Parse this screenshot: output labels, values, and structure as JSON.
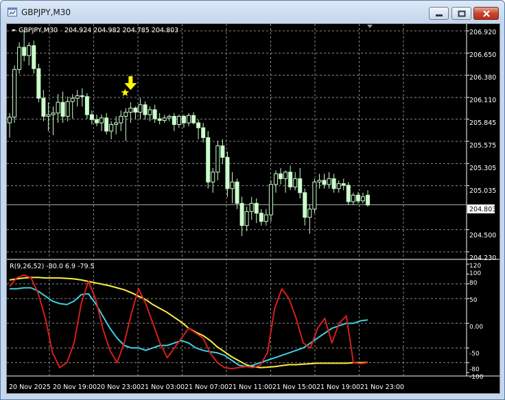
{
  "window": {
    "title": "GBPJPY,M30"
  },
  "chart_header": {
    "symbol": "GBPJPY,M30",
    "ohlc": "204.924 204.982 204.785 204.803"
  },
  "price_axis": {
    "labels": [
      "206.920",
      "206.650",
      "206.380",
      "206.110",
      "205.845",
      "205.575",
      "205.305",
      "205.035",
      "204.500",
      "204.230"
    ],
    "current_price": "204.803"
  },
  "indicator": {
    "label": "R(9,26,52) -80.0 6.9 -79.5",
    "axis_labels": [
      "120",
      "100",
      "80",
      "50",
      "0.00",
      "-50",
      "-80",
      "-100"
    ]
  },
  "time_axis": {
    "labels": [
      "20 Nov 2025",
      "20 Nov 19:00",
      "20 Nov 23:00",
      "21 Nov 03:00",
      "21 Nov 07:00",
      "21 Nov 11:00",
      "21 Nov 15:00",
      "21 Nov 19:00",
      "21 Nov 23:00"
    ]
  },
  "colors": {
    "background": "#000000",
    "grid": "#8c8c8c",
    "candle": "#ccffcc",
    "current_price_line": "#b4b4b4",
    "marker": "#ffff00",
    "fast_line": "#d81e1e",
    "mid_line": "#40d0e0",
    "slow_line": "#ffee40"
  },
  "icons": {
    "app": "chart-window-icon",
    "signal_marker": "down-arrow-icon",
    "signal_star": "star-icon"
  },
  "chart_data": {
    "type": "candlestick",
    "price_range": [
      204.23,
      206.92
    ],
    "candles": [
      [
        205.8,
        205.92,
        205.62,
        205.87
      ],
      [
        205.87,
        206.5,
        205.8,
        206.45
      ],
      [
        206.45,
        206.78,
        206.4,
        206.72
      ],
      [
        206.72,
        206.92,
        206.55,
        206.62
      ],
      [
        206.62,
        206.78,
        206.5,
        206.74
      ],
      [
        206.74,
        206.8,
        206.4,
        206.46
      ],
      [
        206.46,
        206.52,
        206.05,
        206.1
      ],
      [
        206.1,
        206.2,
        205.82,
        205.88
      ],
      [
        205.88,
        206.05,
        205.7,
        205.9
      ],
      [
        205.9,
        206.0,
        205.65,
        205.92
      ],
      [
        205.92,
        206.15,
        205.8,
        206.05
      ],
      [
        206.05,
        206.18,
        205.8,
        205.88
      ],
      [
        205.88,
        206.12,
        205.82,
        206.06
      ],
      [
        206.06,
        206.15,
        205.85,
        206.1
      ],
      [
        206.1,
        206.2,
        206.0,
        206.13
      ],
      [
        206.13,
        206.22,
        206.0,
        206.12
      ],
      [
        206.12,
        206.16,
        205.85,
        205.9
      ],
      [
        205.9,
        205.95,
        205.78,
        205.84
      ],
      [
        205.84,
        205.9,
        205.76,
        205.8
      ],
      [
        205.8,
        205.9,
        205.7,
        205.86
      ],
      [
        205.86,
        205.92,
        205.66,
        205.7
      ],
      [
        205.7,
        205.82,
        205.6,
        205.78
      ],
      [
        205.78,
        205.88,
        205.66,
        205.8
      ],
      [
        205.8,
        205.95,
        205.7,
        205.88
      ],
      [
        205.88,
        205.98,
        205.58,
        205.93
      ],
      [
        205.93,
        206.05,
        205.8,
        205.98
      ],
      [
        205.98,
        206.0,
        205.85,
        205.93
      ],
      [
        205.93,
        206.1,
        205.85,
        206.02
      ],
      [
        206.02,
        206.06,
        205.84,
        205.9
      ],
      [
        205.9,
        206.0,
        205.82,
        205.96
      ],
      [
        205.96,
        206.02,
        205.8,
        205.85
      ],
      [
        205.85,
        205.92,
        205.78,
        205.83
      ],
      [
        205.83,
        205.9,
        205.8,
        205.86
      ],
      [
        205.86,
        205.9,
        205.82,
        205.88
      ],
      [
        205.88,
        205.92,
        205.7,
        205.78
      ],
      [
        205.78,
        205.9,
        205.74,
        205.88
      ],
      [
        205.88,
        205.9,
        205.74,
        205.8
      ],
      [
        205.8,
        205.92,
        205.76,
        205.89
      ],
      [
        205.89,
        205.93,
        205.78,
        205.8
      ],
      [
        205.8,
        205.84,
        205.6,
        205.74
      ],
      [
        205.74,
        205.8,
        205.56,
        205.62
      ],
      [
        205.62,
        205.7,
        205.0,
        205.08
      ],
      [
        205.08,
        205.25,
        204.95,
        205.2
      ],
      [
        205.2,
        205.58,
        205.1,
        205.52
      ],
      [
        205.52,
        205.6,
        205.3,
        205.38
      ],
      [
        205.38,
        205.45,
        204.9,
        205.0
      ],
      [
        205.0,
        205.2,
        204.82,
        205.08
      ],
      [
        205.08,
        205.12,
        204.75,
        204.82
      ],
      [
        204.82,
        204.9,
        204.42,
        204.55
      ],
      [
        204.55,
        204.78,
        204.48,
        204.72
      ],
      [
        204.72,
        204.9,
        204.62,
        204.82
      ],
      [
        204.82,
        204.88,
        204.58,
        204.7
      ],
      [
        204.7,
        204.75,
        204.55,
        204.6
      ],
      [
        204.6,
        204.75,
        204.55,
        204.68
      ],
      [
        204.68,
        205.1,
        204.6,
        205.05
      ],
      [
        205.05,
        205.22,
        204.95,
        205.18
      ],
      [
        205.18,
        205.25,
        205.05,
        205.12
      ],
      [
        205.12,
        205.22,
        204.95,
        205.2
      ],
      [
        205.2,
        205.28,
        204.98,
        205.02
      ],
      [
        205.02,
        205.2,
        204.98,
        205.12
      ],
      [
        205.12,
        205.25,
        204.88,
        204.95
      ],
      [
        204.95,
        205.0,
        204.55,
        204.65
      ],
      [
        204.65,
        204.8,
        204.45,
        204.75
      ],
      [
        204.75,
        205.12,
        204.7,
        205.08
      ],
      [
        205.08,
        205.18,
        205.0,
        205.1
      ],
      [
        205.1,
        205.18,
        205.0,
        205.05
      ],
      [
        205.05,
        205.2,
        205.0,
        205.12
      ],
      [
        205.12,
        205.18,
        204.95,
        205.0
      ],
      [
        205.0,
        205.1,
        204.95,
        205.06
      ],
      [
        205.06,
        205.12,
        204.98,
        205.04
      ],
      [
        205.04,
        205.08,
        204.8,
        204.84
      ],
      [
        204.84,
        204.95,
        204.8,
        204.92
      ],
      [
        204.92,
        204.96,
        204.82,
        204.85
      ],
      [
        204.85,
        204.95,
        204.82,
        204.9
      ],
      [
        204.92,
        204.98,
        204.78,
        204.8
      ]
    ],
    "signal_candle_index": 25,
    "indicator": {
      "range": [
        -100,
        120
      ],
      "fast": [
        75,
        92,
        98,
        92,
        60,
        10,
        -60,
        -90,
        -80,
        -40,
        40,
        85,
        50,
        -10,
        -55,
        -80,
        -40,
        20,
        70,
        40,
        0,
        -40,
        -70,
        -50,
        -30,
        -10,
        -20,
        -30,
        -60,
        -80,
        -90,
        -92,
        -90,
        -88,
        -90,
        -85,
        -60,
        30,
        70,
        50,
        10,
        -40,
        -50,
        -10,
        10,
        -40,
        0,
        15,
        -80,
        -82,
        -80
      ],
      "mid": [
        70,
        70,
        72,
        72,
        65,
        55,
        45,
        40,
        38,
        45,
        58,
        60,
        40,
        15,
        -10,
        -30,
        -45,
        -50,
        -50,
        -55,
        -50,
        -45,
        -45,
        -40,
        -35,
        -40,
        -50,
        -55,
        -58,
        -60,
        -65,
        -75,
        -85,
        -88,
        -85,
        -80,
        -75,
        -70,
        -65,
        -60,
        -55,
        -50,
        -40,
        -30,
        -20,
        -10,
        -5,
        0,
        0,
        5,
        7
      ],
      "slow": [
        88,
        90,
        92,
        93,
        93,
        92,
        92,
        92,
        91,
        90,
        88,
        85,
        82,
        79,
        76,
        72,
        68,
        62,
        55,
        48,
        38,
        30,
        22,
        12,
        2,
        -10,
        -18,
        -25,
        -35,
        -48,
        -58,
        -68,
        -76,
        -84,
        -88,
        -90,
        -89,
        -88,
        -86,
        -84,
        -84,
        -83,
        -82,
        -81,
        -81,
        -81,
        -81,
        -81,
        -80,
        -80,
        -79.5
      ]
    }
  }
}
